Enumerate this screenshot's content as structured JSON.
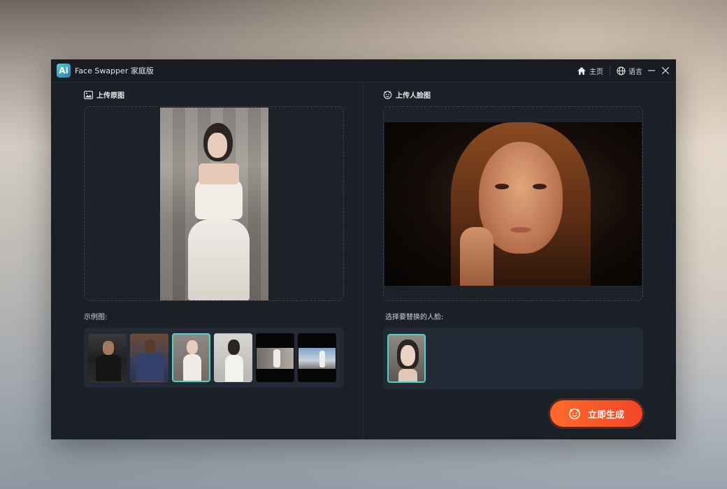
{
  "window": {
    "logo_text": "Ai",
    "title": "Face Swapper 家庭版",
    "home_label": "主页",
    "language_label": "语言"
  },
  "left": {
    "upload_title": "上传原图",
    "examples_label": "示例图:"
  },
  "right": {
    "upload_title": "上传人脸图",
    "faces_label": "选择要替换的人脸:"
  },
  "actions": {
    "generate_label": "立即生成"
  },
  "colors": {
    "accent": "#4fd1c5",
    "generate_button": "#f0552a",
    "window_bg": "#1b1f26"
  }
}
